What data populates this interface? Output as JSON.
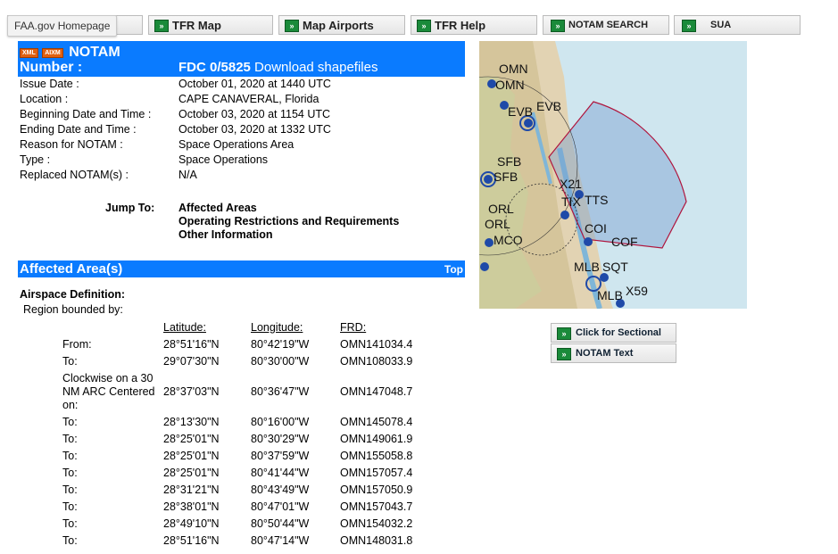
{
  "tooltip": "FAA.gov Homepage",
  "nav": [
    {
      "label": ""
    },
    {
      "label": "TFR Map"
    },
    {
      "label": "Map Airports"
    },
    {
      "label": "TFR Help"
    },
    {
      "label": "NOTAM SEARCH"
    },
    {
      "label": "SUA"
    }
  ],
  "header": {
    "xml_badge": "XML",
    "aixm_badge": "AIXM",
    "title": "NOTAM",
    "number_label": "Number :",
    "number_value": "FDC 0/5825",
    "download_link": "Download shapefiles"
  },
  "details": [
    {
      "label": "Issue Date :",
      "value": "October 01, 2020 at 1440 UTC"
    },
    {
      "label": "Location :",
      "value": "CAPE CANAVERAL, Florida"
    },
    {
      "label": "Beginning Date and Time :",
      "value": "October 03, 2020 at 1154 UTC"
    },
    {
      "label": "Ending Date and Time :",
      "value": "October 03, 2020 at 1332 UTC"
    },
    {
      "label": "Reason for NOTAM :",
      "value": "Space Operations Area"
    },
    {
      "label": "Type :",
      "value": "Space Operations"
    },
    {
      "label": "Replaced NOTAM(s) :",
      "value": "N/A"
    }
  ],
  "jump": {
    "label": "Jump To:",
    "links": [
      "Affected Areas",
      "Operating Restrictions and Requirements",
      "Other Information"
    ]
  },
  "affected": {
    "title": "Affected Area(s)",
    "top_link": "Top",
    "airspace_def": "Airspace Definition:",
    "region": "Region bounded by:",
    "headers": [
      "Latitude:",
      "Longitude:",
      "FRD:"
    ],
    "rows": [
      {
        "kind": "From:",
        "lat": "28°51'16\"N",
        "lon": "80°42'19\"W",
        "frd": "OMN141034.4"
      },
      {
        "kind": "To:",
        "lat": "29°07'30\"N",
        "lon": "80°30'00\"W",
        "frd": "OMN108033.9"
      },
      {
        "kind": "Clockwise on a 30 NM ARC Centered on:",
        "lat": "28°37'03\"N",
        "lon": "80°36'47\"W",
        "frd": "OMN147048.7"
      },
      {
        "kind": "To:",
        "lat": "28°13'30\"N",
        "lon": "80°16'00\"W",
        "frd": "OMN145078.4"
      },
      {
        "kind": "To:",
        "lat": "28°25'01\"N",
        "lon": "80°30'29\"W",
        "frd": "OMN149061.9"
      },
      {
        "kind": "To:",
        "lat": "28°25'01\"N",
        "lon": "80°37'59\"W",
        "frd": "OMN155058.8"
      },
      {
        "kind": "To:",
        "lat": "28°25'01\"N",
        "lon": "80°41'44\"W",
        "frd": "OMN157057.4"
      },
      {
        "kind": "To:",
        "lat": "28°31'21\"N",
        "lon": "80°43'49\"W",
        "frd": "OMN157050.9"
      },
      {
        "kind": "To:",
        "lat": "28°38'01\"N",
        "lon": "80°47'01\"W",
        "frd": "OMN157043.7"
      },
      {
        "kind": "To:",
        "lat": "28°49'10\"N",
        "lon": "80°50'44\"W",
        "frd": "OMN154032.2"
      },
      {
        "kind": "To:",
        "lat": "28°51'16\"N",
        "lon": "80°47'14\"W",
        "frd": "OMN148031.8"
      }
    ]
  },
  "side": {
    "sectional": "Click for Sectional",
    "notam_text": "NOTAM Text"
  },
  "map_labels": [
    "OMN",
    "OMN",
    "EVB",
    "EVB",
    "SFB",
    "SFB",
    "X21",
    "TIX",
    "TTS",
    "ORL",
    "ORL",
    "MCO",
    "COI",
    "COF",
    "MLB",
    "SQT",
    "MLB",
    "X59"
  ]
}
